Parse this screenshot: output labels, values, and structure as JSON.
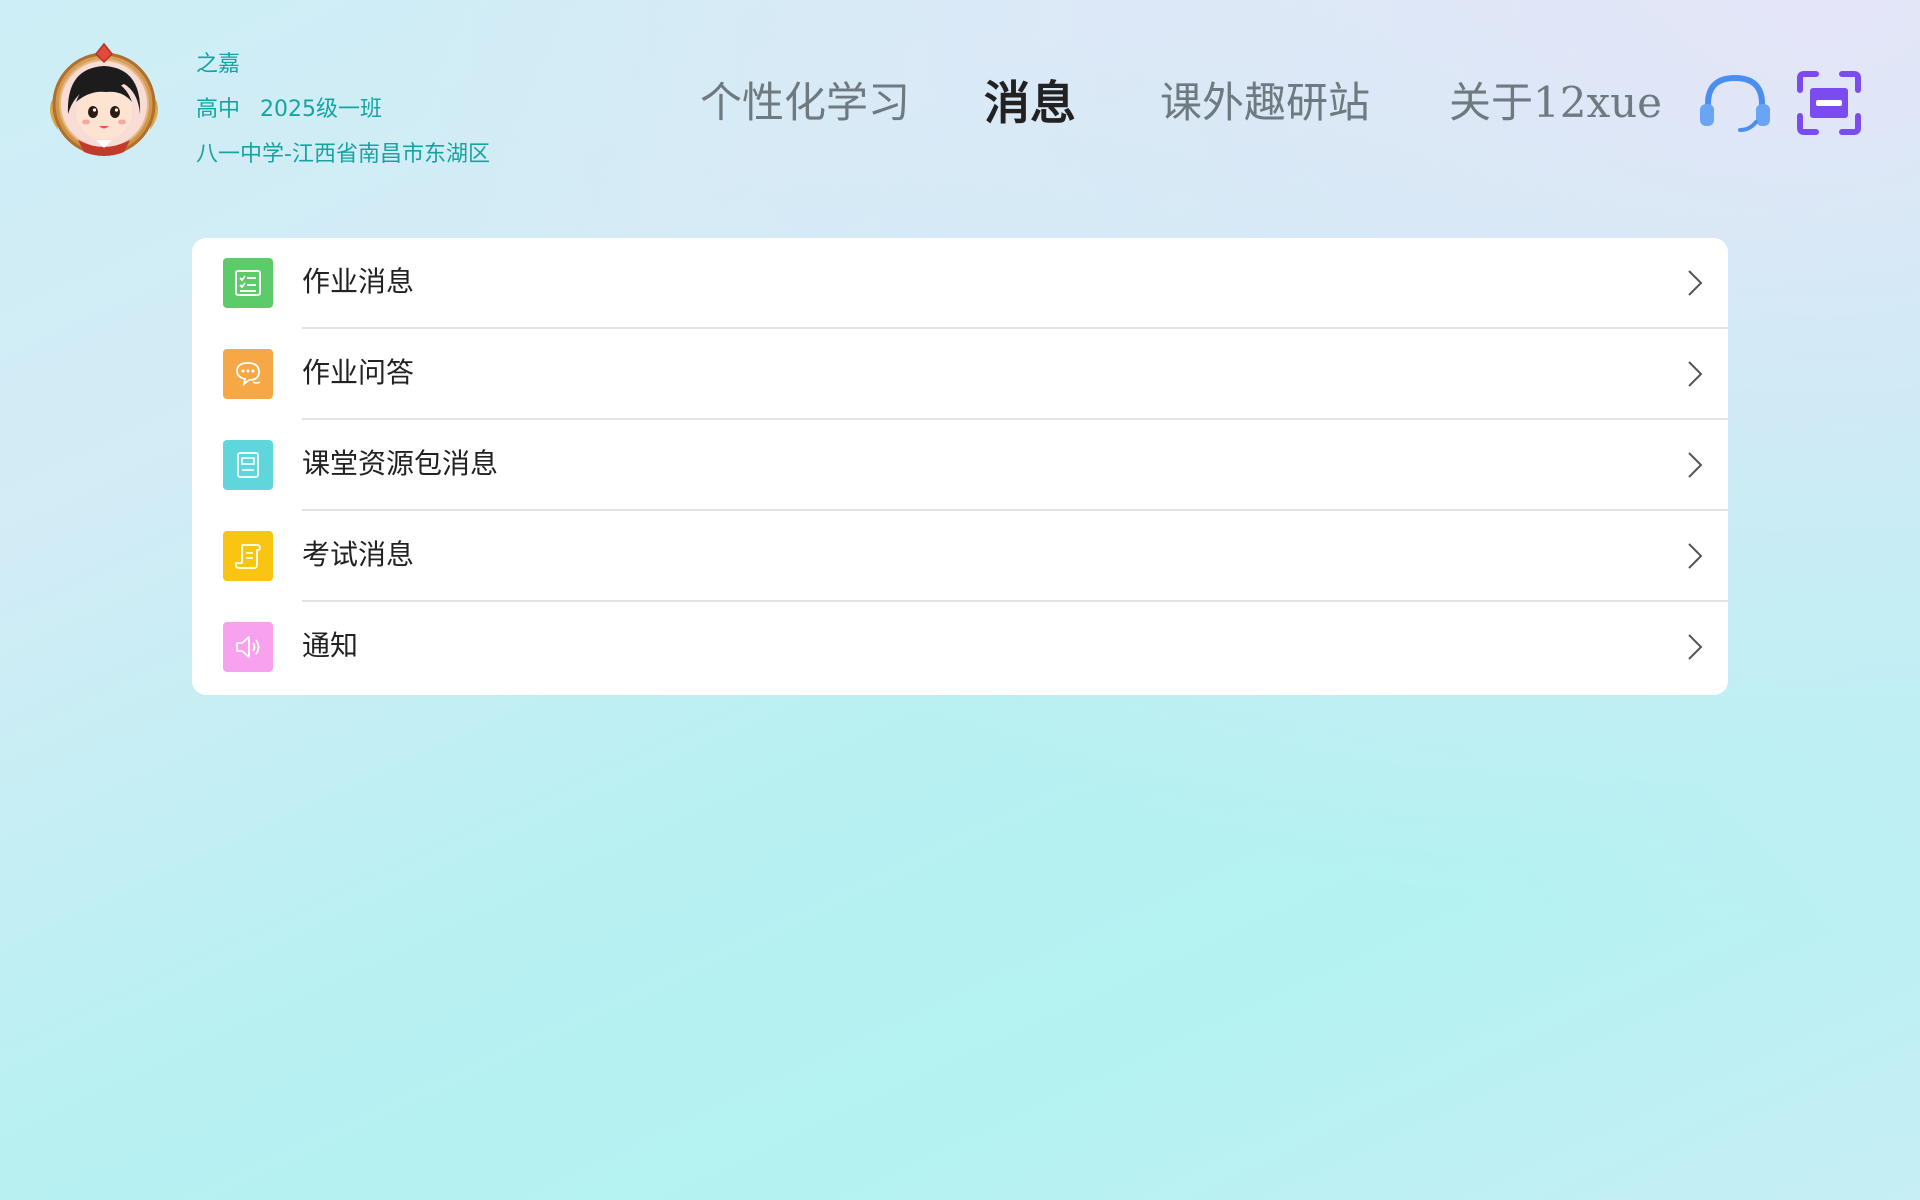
{
  "user": {
    "name": "之嘉",
    "grade": "高中",
    "class_name": "2025级一班",
    "school": "八一中学-江西省南昌市东湖区"
  },
  "nav": {
    "tabs": [
      {
        "label": "个性化学习",
        "active": false
      },
      {
        "label": "消息",
        "active": true
      },
      {
        "label": "课外趣研站",
        "active": false
      },
      {
        "label": "关于12xue",
        "active": false
      }
    ],
    "icons": [
      "headset-icon",
      "scan-icon"
    ]
  },
  "messages": {
    "items": [
      {
        "label": "作业消息",
        "icon": "homework-checklist-icon",
        "color": "#5ccb6a"
      },
      {
        "label": "作业问答",
        "icon": "chat-bubbles-icon",
        "color": "#f7a846"
      },
      {
        "label": "课堂资源包消息",
        "icon": "resource-package-icon",
        "color": "#5fd6dc"
      },
      {
        "label": "考试消息",
        "icon": "exam-scroll-icon",
        "color": "#f9c412"
      },
      {
        "label": "通知",
        "icon": "speaker-icon",
        "color": "#f8a2ef"
      }
    ]
  },
  "colors": {
    "user_info": "#17a3a0",
    "nav_inactive": "#6e7a80",
    "nav_active": "#222222",
    "headset": "#4a8ef0",
    "scan": "#7a4cf0"
  }
}
